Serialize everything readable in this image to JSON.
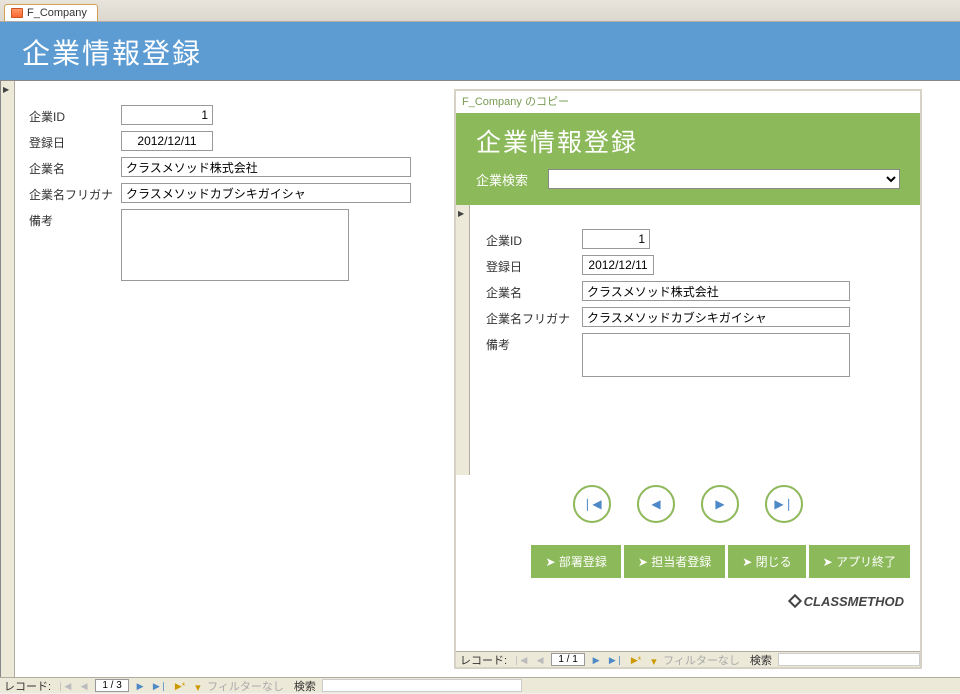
{
  "tab": {
    "label": "F_Company"
  },
  "header": {
    "title": "企業情報登録"
  },
  "left": {
    "labels": {
      "company_id": "企業ID",
      "reg_date": "登録日",
      "company_name": "企業名",
      "furigana": "企業名フリガナ",
      "remarks": "備考"
    },
    "values": {
      "company_id": "1",
      "reg_date": "2012/12/11",
      "company_name": "クラスメソッド株式会社",
      "furigana": "クラスメソッドカブシキガイシャ",
      "remarks": ""
    }
  },
  "sub": {
    "caption": "F_Company のコピー",
    "title": "企業情報登録",
    "search_label": "企業検索",
    "labels": {
      "company_id": "企業ID",
      "reg_date": "登録日",
      "company_name": "企業名",
      "furigana": "企業名フリガナ",
      "remarks": "備考"
    },
    "values": {
      "company_id": "1",
      "reg_date": "2012/12/11",
      "company_name": "クラスメソッド株式会社",
      "furigana": "クラスメソッドカブシキガイシャ",
      "remarks": ""
    },
    "buttons": {
      "dept": "➤ 部署登録",
      "person": "➤ 担当者登録",
      "close": "➤ 閉じる",
      "exit": "➤ アプリ終了"
    },
    "logo": "CLASSMETHOD"
  },
  "recnav_main": {
    "label": "レコード:",
    "pos": "1 / 3",
    "filter": "フィルターなし",
    "search_label": "検索"
  },
  "recnav_sub": {
    "label": "レコード:",
    "pos": "1 / 1",
    "filter": "フィルターなし",
    "search_label": "検索"
  }
}
